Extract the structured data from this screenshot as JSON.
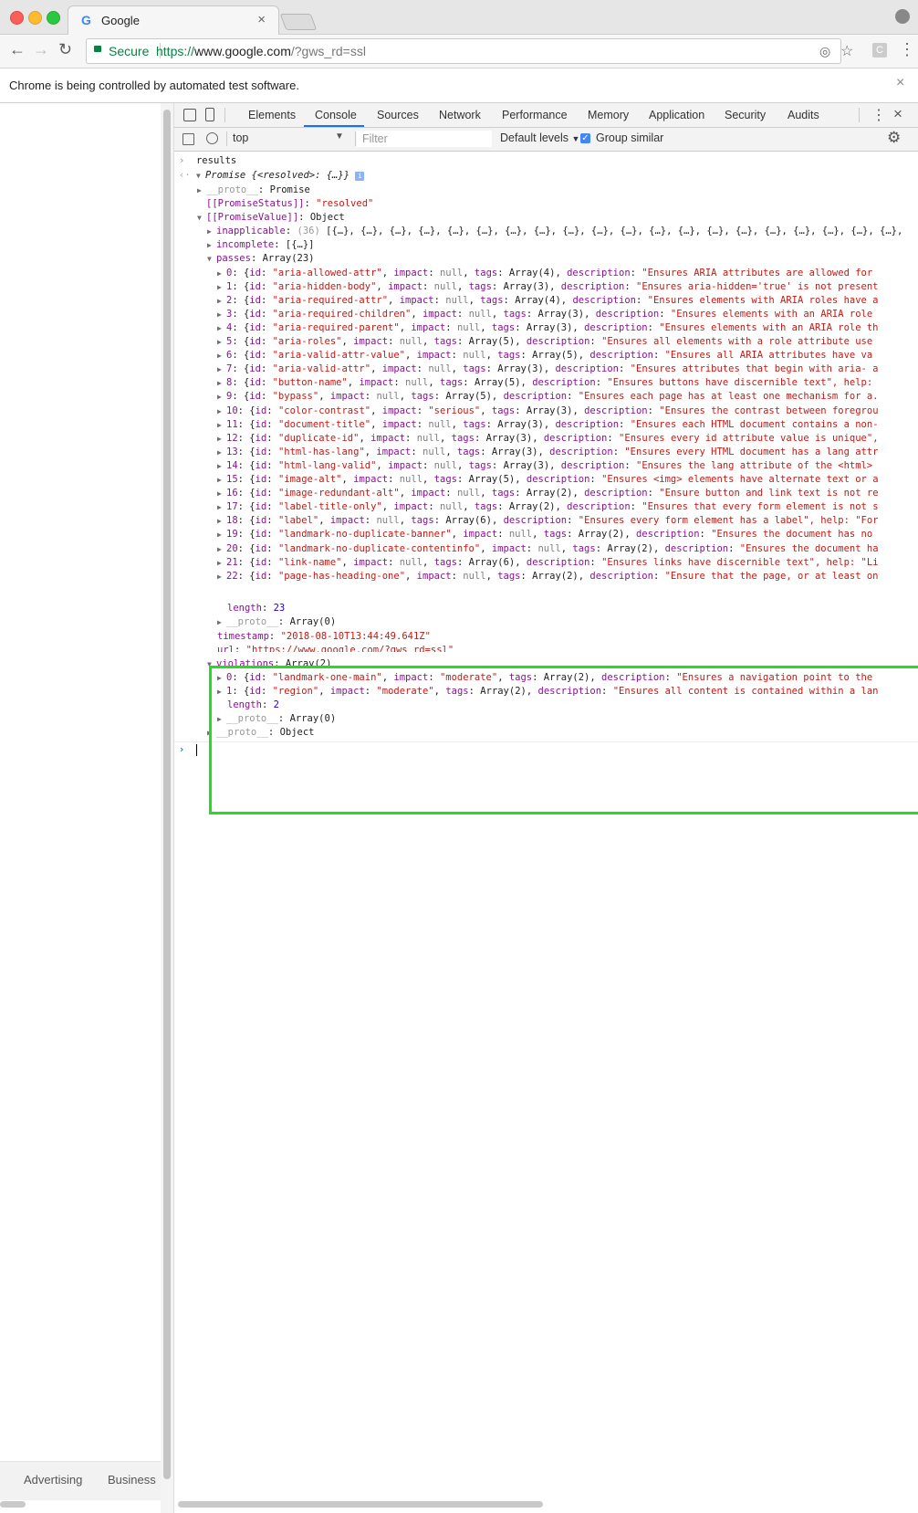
{
  "browser": {
    "tab_title": "Google",
    "secure_label": "Secure",
    "url_scheme": "https://",
    "url_host": "www.google.com",
    "url_path": "/?gws_rd=ssl",
    "infobar_text": "Chrome is being controlled by automated test software.",
    "close_glyph": "×"
  },
  "page_footer": {
    "advertising": "Advertising",
    "business": "Business"
  },
  "devtools": {
    "tabs": [
      "Elements",
      "Console",
      "Sources",
      "Network",
      "Performance",
      "Memory",
      "Application",
      "Security",
      "Audits"
    ],
    "active_tab": "Console",
    "context": "top",
    "filter_placeholder": "Filter",
    "levels": "Default levels",
    "group_similar": "Group similar"
  },
  "console": {
    "input_cmd": "results",
    "promise_label": "Promise {<resolved>: {…}}",
    "proto_promise": "Promise",
    "promise_status_key": "[[PromiseStatus]]",
    "promise_status_val": "\"resolved\"",
    "promise_value_key": "[[PromiseValue]]",
    "promise_value_val": "Object",
    "inapplicable_count": "(36)",
    "inapplicable_val": "[{…}, {…}, {…}, {…}, {…}, {…}, {…}, {…}, {…}, {…}, {…}, {…}, {…}, {…}, {…}, {…}, {…}, {…}, {…}, {…},",
    "incomplete_val": "[{…}]",
    "passes_val": "Array(23)",
    "passes": [
      {
        "i": "0",
        "id": "\"aria-allowed-attr\"",
        "impact": "null",
        "tags": "Array(4)",
        "desc": "\"Ensures ARIA attributes are allowed for"
      },
      {
        "i": "1",
        "id": "\"aria-hidden-body\"",
        "impact": "null",
        "tags": "Array(3)",
        "desc": "\"Ensures aria-hidden='true' is not present"
      },
      {
        "i": "2",
        "id": "\"aria-required-attr\"",
        "impact": "null",
        "tags": "Array(4)",
        "desc": "\"Ensures elements with ARIA roles have a"
      },
      {
        "i": "3",
        "id": "\"aria-required-children\"",
        "impact": "null",
        "tags": "Array(3)",
        "desc": "\"Ensures elements with an ARIA role"
      },
      {
        "i": "4",
        "id": "\"aria-required-parent\"",
        "impact": "null",
        "tags": "Array(3)",
        "desc": "\"Ensures elements with an ARIA role th"
      },
      {
        "i": "5",
        "id": "\"aria-roles\"",
        "impact": "null",
        "tags": "Array(5)",
        "desc": "\"Ensures all elements with a role attribute use"
      },
      {
        "i": "6",
        "id": "\"aria-valid-attr-value\"",
        "impact": "null",
        "tags": "Array(5)",
        "desc": "\"Ensures all ARIA attributes have va"
      },
      {
        "i": "7",
        "id": "\"aria-valid-attr\"",
        "impact": "null",
        "tags": "Array(3)",
        "desc": "\"Ensures attributes that begin with aria- a"
      },
      {
        "i": "8",
        "id": "\"button-name\"",
        "impact": "null",
        "tags": "Array(5)",
        "desc": "\"Ensures buttons have discernible text\", help:"
      },
      {
        "i": "9",
        "id": "\"bypass\"",
        "impact": "null",
        "tags": "Array(5)",
        "desc": "\"Ensures each page has at least one mechanism for a."
      },
      {
        "i": "10",
        "id": "\"color-contrast\"",
        "impact": "\"serious\"",
        "tags": "Array(3)",
        "desc": "\"Ensures the contrast between foregrou"
      },
      {
        "i": "11",
        "id": "\"document-title\"",
        "impact": "null",
        "tags": "Array(3)",
        "desc": "\"Ensures each HTML document contains a non-"
      },
      {
        "i": "12",
        "id": "\"duplicate-id\"",
        "impact": "null",
        "tags": "Array(3)",
        "desc": "\"Ensures every id attribute value is unique\","
      },
      {
        "i": "13",
        "id": "\"html-has-lang\"",
        "impact": "null",
        "tags": "Array(3)",
        "desc": "\"Ensures every HTML document has a lang attr"
      },
      {
        "i": "14",
        "id": "\"html-lang-valid\"",
        "impact": "null",
        "tags": "Array(3)",
        "desc": "\"Ensures the lang attribute of the <html>"
      },
      {
        "i": "15",
        "id": "\"image-alt\"",
        "impact": "null",
        "tags": "Array(5)",
        "desc": "\"Ensures <img> elements have alternate text or a"
      },
      {
        "i": "16",
        "id": "\"image-redundant-alt\"",
        "impact": "null",
        "tags": "Array(2)",
        "desc": "\"Ensure button and link text is not re"
      },
      {
        "i": "17",
        "id": "\"label-title-only\"",
        "impact": "null",
        "tags": "Array(2)",
        "desc": "\"Ensures that every form element is not s"
      },
      {
        "i": "18",
        "id": "\"label\"",
        "impact": "null",
        "tags": "Array(6)",
        "desc": "\"Ensures every form element has a label\", help: \"For"
      },
      {
        "i": "19",
        "id": "\"landmark-no-duplicate-banner\"",
        "impact": "null",
        "tags": "Array(2)",
        "desc": "\"Ensures the document has no"
      },
      {
        "i": "20",
        "id": "\"landmark-no-duplicate-contentinfo\"",
        "impact": "null",
        "tags": "Array(2)",
        "desc": "\"Ensures the document ha"
      },
      {
        "i": "21",
        "id": "\"link-name\"",
        "impact": "null",
        "tags": "Array(6)",
        "desc": "\"Ensures links have discernible text\", help: \"Li"
      },
      {
        "i": "22",
        "id": "\"page-has-heading-one\"",
        "impact": "null",
        "tags": "Array(2)",
        "desc": "\"Ensure that the page, or at least on"
      }
    ],
    "length_key": "length",
    "passes_length": "23",
    "proto_key": "__proto__",
    "array0": "Array(0)",
    "timestamp_val": "\"2018-08-10T13:44:49.641Z\"",
    "url_val": "\"https://www.google.com/?gws_rd=ssl\"",
    "violations_val": "Array(2)",
    "violations": [
      {
        "i": "0",
        "id": "\"landmark-one-main\"",
        "impact": "\"moderate\"",
        "tags": "Array(2)",
        "desc": "\"Ensures a navigation point to the"
      },
      {
        "i": "1",
        "id": "\"region\"",
        "impact": "\"moderate\"",
        "tags": "Array(2)",
        "desc": "\"Ensures all content is contained within a lan"
      }
    ],
    "violations_length": "2",
    "object_label": "Object"
  }
}
